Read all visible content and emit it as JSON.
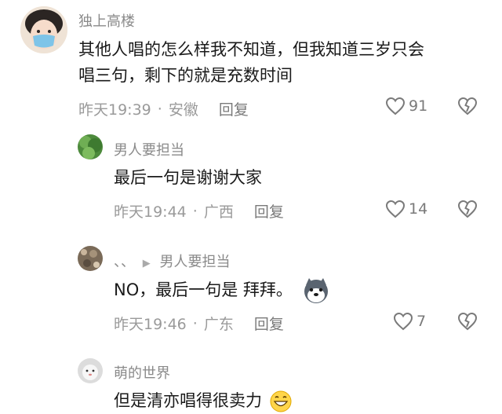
{
  "comments": [
    {
      "username": "独上高楼",
      "text_lines": [
        "其他人唱的怎么样我不知道，但我知道三岁只会",
        "唱三句，剩下的就是充数时间"
      ],
      "time": "昨天19:39",
      "location": "安徽",
      "reply_label": "回复",
      "likes": "91",
      "avatar_icon": "masked-child-avatar"
    },
    {
      "username": "男人要担当",
      "text": "最后一句是谢谢大家",
      "time": "昨天19:44",
      "location": "广西",
      "reply_label": "回复",
      "likes": "14",
      "avatar_icon": "green-leaf-avatar"
    },
    {
      "username": "、、",
      "reply_to": "男人要担当",
      "text": "NO，最后一句是 拜拜。",
      "emoji": "husky-dog-emoji",
      "time": "昨天19:46",
      "location": "广东",
      "reply_label": "回复",
      "likes": "7",
      "avatar_icon": "textured-photo-avatar"
    },
    {
      "username": "萌的世界",
      "text": "但是清亦唱得很卖力",
      "emoji": "grinning-face-emoji",
      "avatar_icon": "white-pet-avatar"
    }
  ],
  "colors": {
    "username": "#8a8a8a",
    "text": "#1a1a1a",
    "meta": "#9a9a9a",
    "icon": "#7a7a7a"
  }
}
